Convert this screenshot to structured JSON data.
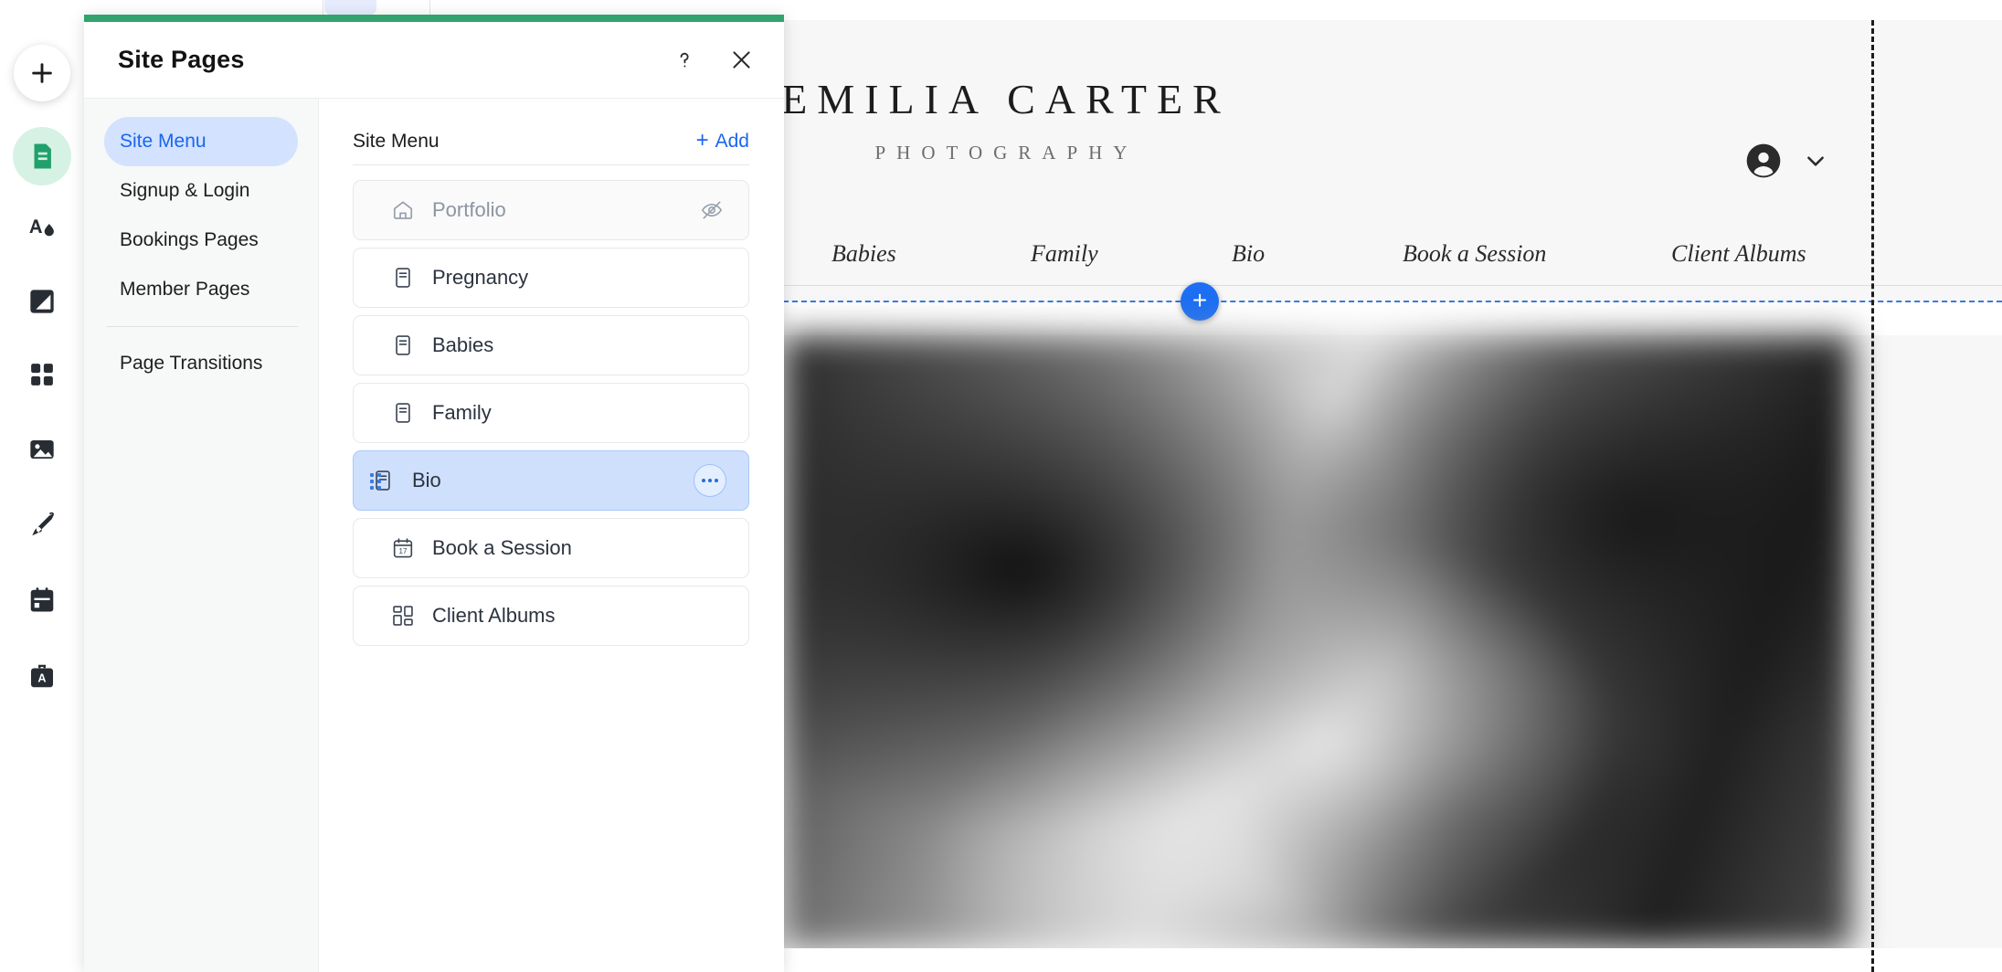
{
  "rail": {
    "items": [
      {
        "name": "add-element-button",
        "icon": "plus-icon"
      },
      {
        "name": "site-pages-button",
        "icon": "pages-document-icon",
        "active": true
      },
      {
        "name": "site-design-button",
        "icon": "theme-letter-droplet-icon"
      },
      {
        "name": "background-button",
        "icon": "background-square-icon"
      },
      {
        "name": "apps-button",
        "icon": "apps-grid-icon"
      },
      {
        "name": "media-button",
        "icon": "image-icon"
      },
      {
        "name": "blog-button",
        "icon": "pen-nib-icon"
      },
      {
        "name": "bookings-button",
        "icon": "calendar-icon"
      },
      {
        "name": "business-tools-button",
        "icon": "briefcase-a-icon"
      }
    ]
  },
  "panel": {
    "title": "Site Pages",
    "help_icon": "question-mark-icon",
    "close_icon": "close-x-icon",
    "accent_color": "#30a46c",
    "nav": [
      {
        "label": "Site Menu",
        "active": true
      },
      {
        "label": "Signup & Login",
        "active": false
      },
      {
        "label": "Bookings Pages",
        "active": false
      },
      {
        "label": "Member Pages",
        "active": false
      }
    ],
    "nav_after_divider": [
      {
        "label": "Page Transitions",
        "active": false
      }
    ],
    "main": {
      "heading": "Site Menu",
      "add_label": "Add",
      "add_plus": "+",
      "pages": [
        {
          "label": "Portfolio",
          "icon": "home-icon",
          "state": "hidden",
          "trailing": "eye-hidden-icon"
        },
        {
          "label": "Pregnancy",
          "icon": "page-icon",
          "state": "normal",
          "trailing": "none"
        },
        {
          "label": "Babies",
          "icon": "page-icon",
          "state": "normal",
          "trailing": "none"
        },
        {
          "label": "Family",
          "icon": "page-icon",
          "state": "normal",
          "trailing": "none"
        },
        {
          "label": "Bio",
          "icon": "page-icon",
          "state": "selected",
          "trailing": "more-options-icon"
        },
        {
          "label": "Book a Session",
          "icon": "calendar-17-icon",
          "state": "normal",
          "trailing": "none"
        },
        {
          "label": "Client Albums",
          "icon": "albums-grid-icon",
          "state": "normal",
          "trailing": "none"
        }
      ]
    }
  },
  "site": {
    "brand_name": "EMILIA CARTER",
    "brand_sub": "PHOTOGRAPHY",
    "account_icon": "account-circle-icon",
    "account_chevron_icon": "chevron-down-icon",
    "nav_items": [
      "Babies",
      "Family",
      "Bio",
      "Book a Session",
      "Client Albums"
    ],
    "add_section_label": "+",
    "accent_blue": "#1c6ff3"
  }
}
